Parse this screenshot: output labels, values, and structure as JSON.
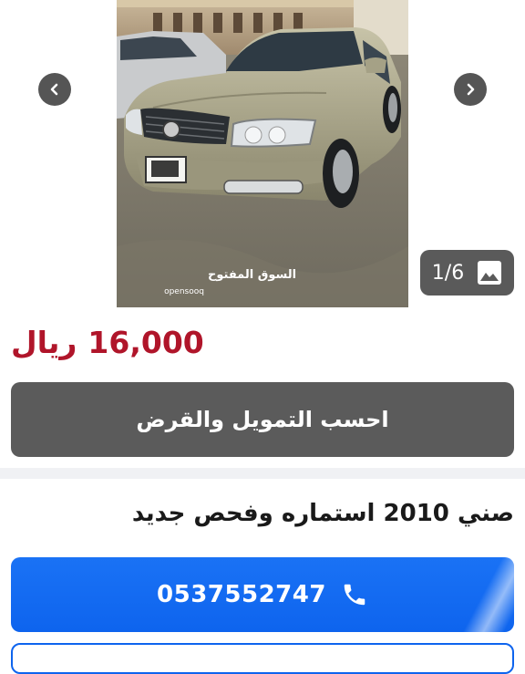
{
  "gallery": {
    "counter": "1/6",
    "photo_caption": "car-photo",
    "watermark_ar": "السوق المفتوح",
    "watermark_en": "opensooq"
  },
  "listing": {
    "price_amount": "16,000",
    "price_currency": "ريال",
    "title": "صني 2010 استماره وفحص جديد"
  },
  "actions": {
    "finance_label": "احسب التمويل والقرض",
    "phone_number": "0537552747"
  },
  "icons": {
    "prev": "chevron-left-icon",
    "next": "chevron-right-icon",
    "gallery": "image-icon",
    "phone": "phone-icon"
  },
  "colors": {
    "price": "#b0152a",
    "call_button": "#0e64ee",
    "finance_button": "#5b5b5b"
  }
}
